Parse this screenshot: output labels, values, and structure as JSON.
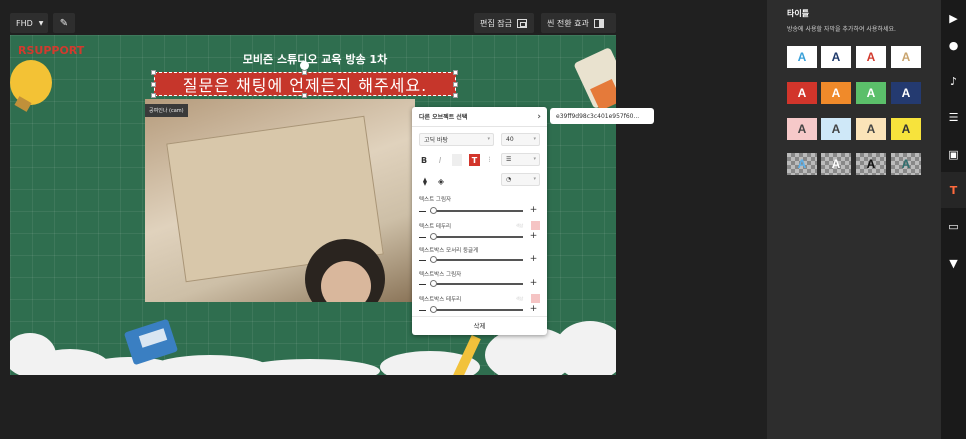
{
  "toolbar": {
    "resolution_label": "FHD",
    "edit_lock_label": "편집 잠금",
    "scene_effect_label": "씬 전환 효과"
  },
  "stage": {
    "logo_text": "RSUPPORT",
    "title": "모비즌 스튜디오 교육 방송 1차",
    "caption_text": "질문은 채팅에 언제든지 해주세요.",
    "camera_label": "공여인나 (cam)"
  },
  "panel": {
    "header": "다른 오브젝트 선택",
    "font_value": "고딕 바탕",
    "size_value": "40",
    "format_bold": "B",
    "format_italic": "I",
    "format_text": "T",
    "sliders": [
      {
        "label": "텍스트 그림자",
        "swatch": false
      },
      {
        "label": "텍스트 테두리",
        "swatch": true,
        "hint": "색상"
      },
      {
        "label": "텍스트박스 모서리 둥글게",
        "swatch": false
      },
      {
        "label": "텍스트박스 그림자",
        "swatch": false
      },
      {
        "label": "텍스트박스 테두리",
        "swatch": true,
        "hint": "색상"
      }
    ],
    "delete_label": "삭제"
  },
  "object_id": "e39ff9d98c3c401e957f60...",
  "sidepanel": {
    "title": "타이틀",
    "description": "방송에 사용할 자막을 추가하여 사용하세요.",
    "tile_letter": "A",
    "tiles": [
      {
        "bg": "#ffffff",
        "fg": "#3aa0d8"
      },
      {
        "bg": "#ffffff",
        "fg": "#1f3a6b"
      },
      {
        "bg": "#ffffff",
        "fg": "#d23a2e"
      },
      {
        "bg": "#ffffff",
        "fg": "#c9a46e"
      },
      {
        "bg": "#d2352b",
        "fg": "#ffffff"
      },
      {
        "bg": "#f08a2a",
        "fg": "#ffffff"
      },
      {
        "bg": "#5bbf6a",
        "fg": "#ffffff"
      },
      {
        "bg": "#243a70",
        "fg": "#ffffff"
      },
      {
        "bg": "#f6c9c9",
        "fg": "#444444"
      },
      {
        "bg": "#cfe8f8",
        "fg": "#444444"
      },
      {
        "bg": "#fbe3b8",
        "fg": "#444444"
      },
      {
        "bg": "#f7e33c",
        "fg": "#333333"
      },
      {
        "bg": "checker",
        "fg": "#5fb0e8"
      },
      {
        "bg": "checker",
        "fg": "#ffffff"
      },
      {
        "bg": "checker",
        "fg": "#111111"
      },
      {
        "bg": "checker",
        "fg": "#2f6e6e"
      }
    ]
  },
  "iconbar": [
    "play-icon",
    "location-pin-icon",
    "music-note-icon",
    "list-icon",
    "image-icon",
    "text-icon",
    "caption-bar-icon",
    "bookmark-icon"
  ]
}
